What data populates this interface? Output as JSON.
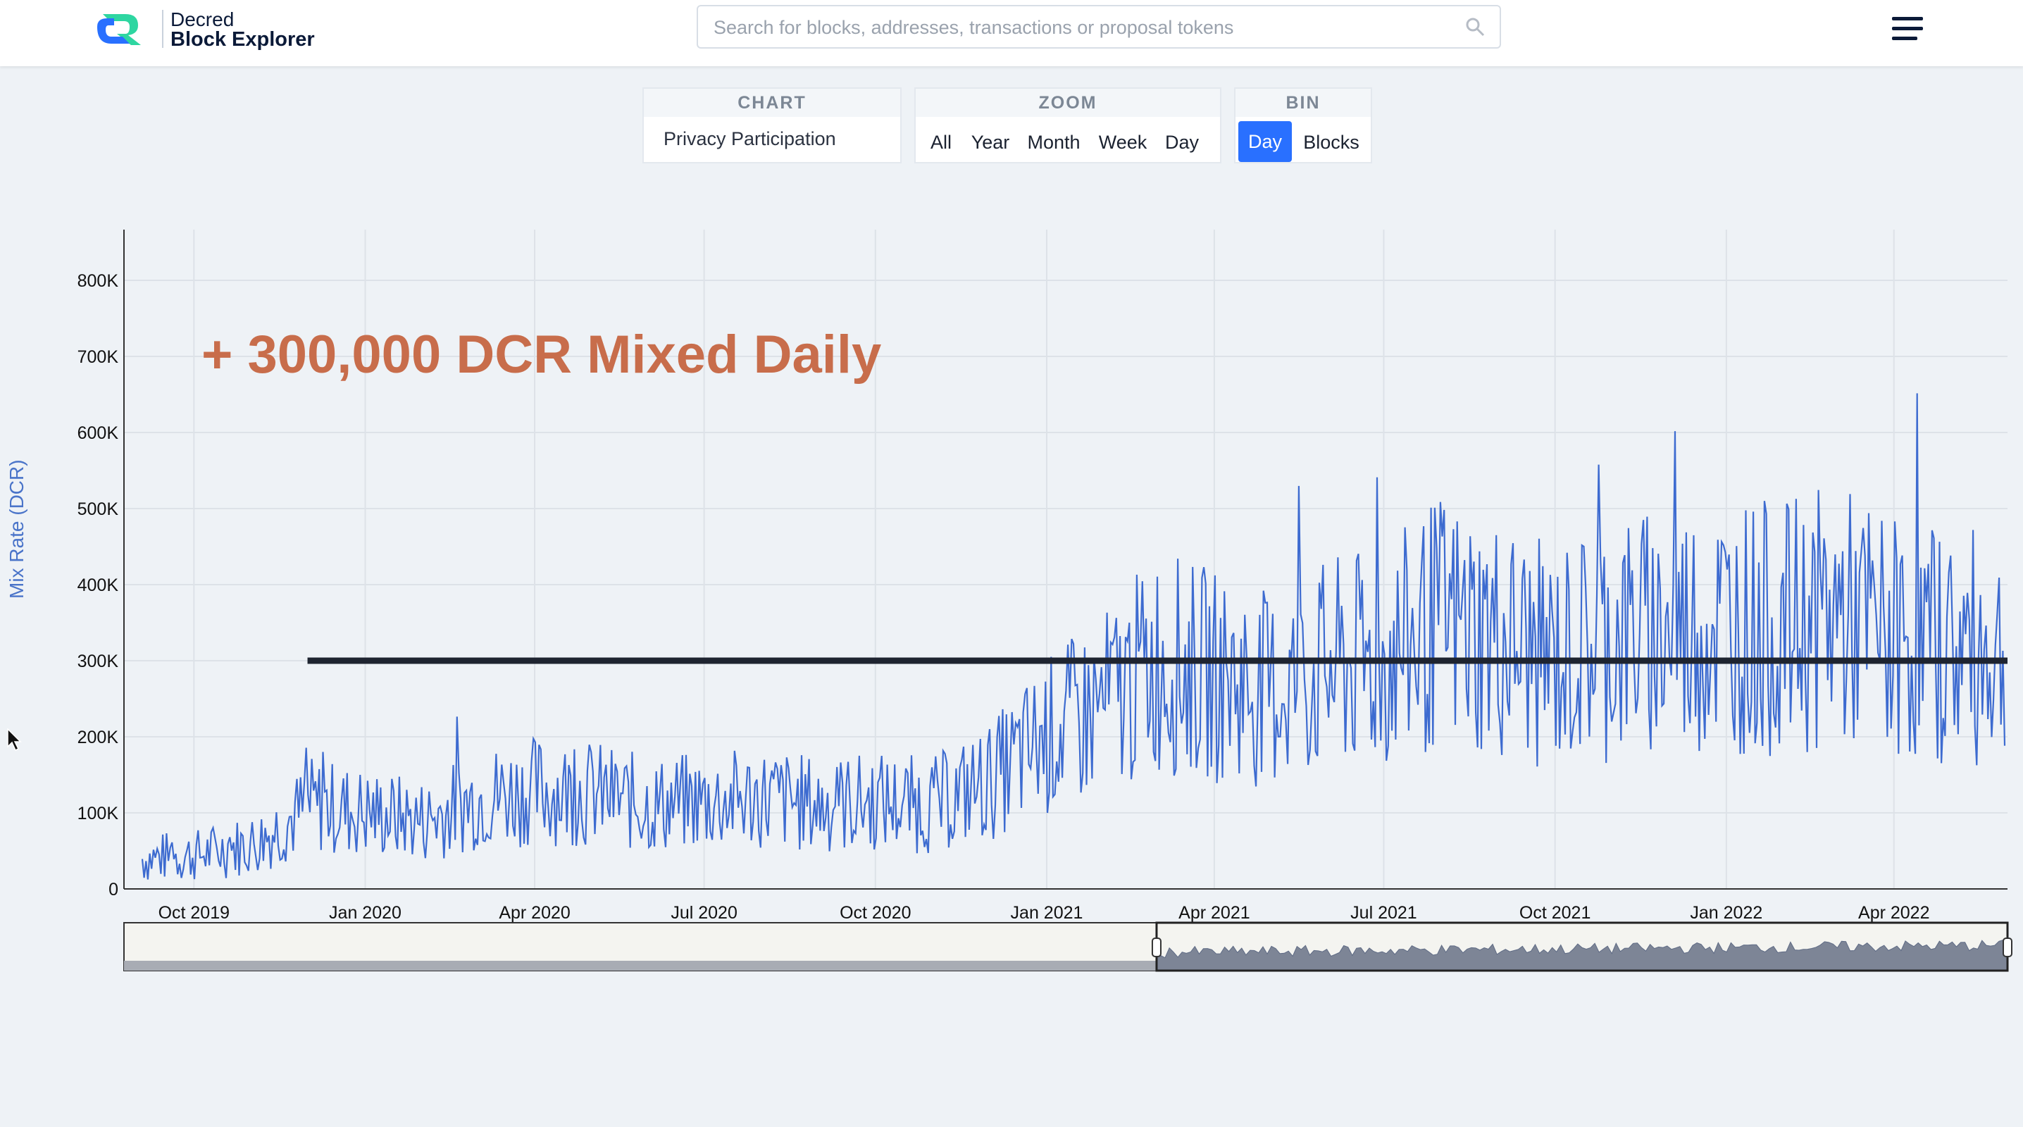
{
  "brand": {
    "line1": "Decred",
    "line2": "Block Explorer"
  },
  "search": {
    "placeholder": "Search for blocks, addresses, transactions or proposal tokens"
  },
  "controls": {
    "chart": {
      "title": "CHART",
      "selected": "Privacy Participation"
    },
    "zoom": {
      "title": "ZOOM",
      "options": [
        "All",
        "Year",
        "Month",
        "Week",
        "Day"
      ]
    },
    "bin": {
      "title": "BIN",
      "options": [
        "Day",
        "Blocks"
      ],
      "selected": "Day"
    }
  },
  "annotation": "+ 300,000 DCR Mixed Daily",
  "colors": {
    "accent": "#2970ff",
    "series": "#3d6bd0",
    "annotation": "#c86d4b",
    "reference_line": "#1e2430"
  },
  "chart_data": {
    "type": "line",
    "ylabel": "Mix Rate (DCR)",
    "ylim": [
      0,
      850000
    ],
    "yticks": [
      "0",
      "100K",
      "200K",
      "300K",
      "400K",
      "500K",
      "600K",
      "700K",
      "800K"
    ],
    "xticks": [
      "Oct 2019",
      "Jan 2020",
      "Apr 2020",
      "Jul 2020",
      "Oct 2020",
      "Jan 2021",
      "Apr 2021",
      "Jul 2021",
      "Oct 2021",
      "Jan 2022",
      "Apr 2022"
    ],
    "x": [
      "2019-09-01",
      "2019-10-01",
      "2019-11-01",
      "2019-12-01",
      "2020-01-01",
      "2020-02-01",
      "2020-03-01",
      "2020-04-01",
      "2020-05-01",
      "2020-06-01",
      "2020-07-01",
      "2020-08-01",
      "2020-09-01",
      "2020-10-01",
      "2020-11-01",
      "2020-12-01",
      "2021-01-01",
      "2021-02-01",
      "2021-03-01",
      "2021-04-01",
      "2021-05-01",
      "2021-06-01",
      "2021-07-01",
      "2021-08-01",
      "2021-09-01",
      "2021-10-01",
      "2021-11-01",
      "2021-12-01",
      "2022-01-01",
      "2022-02-01",
      "2022-03-01",
      "2022-04-01",
      "2022-05-01",
      "2022-06-01"
    ],
    "series": [
      {
        "values": [
          40000,
          45000,
          60000,
          110000,
          100000,
          90000,
          120000,
          130000,
          125000,
          110000,
          115000,
          120000,
          110000,
          115000,
          110000,
          140000,
          200000,
          240000,
          300000,
          280000,
          260000,
          290000,
          300000,
          350000,
          330000,
          300000,
          330000,
          340000,
          350000,
          340000,
          360000,
          330000,
          320000,
          310000
        ]
      }
    ],
    "reference_line": {
      "y": 300000,
      "x_start": "2019-12-01",
      "x_end": "2022-06-01"
    },
    "range_selector": {
      "start": "2021-03-01",
      "end": "2022-06-01"
    },
    "grid": true
  }
}
